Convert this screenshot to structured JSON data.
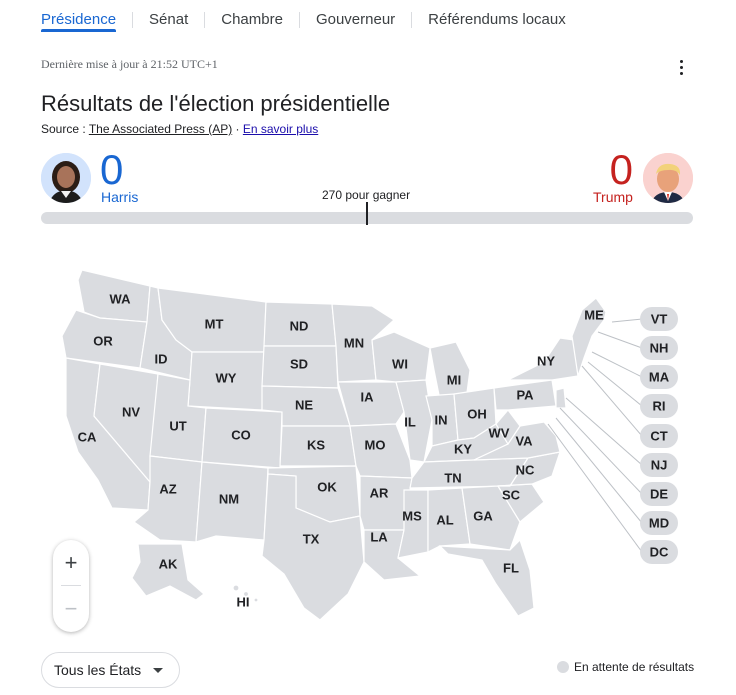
{
  "tabs": [
    {
      "label": "Présidence",
      "active": true
    },
    {
      "label": "Sénat",
      "active": false
    },
    {
      "label": "Chambre",
      "active": false
    },
    {
      "label": "Gouverneur",
      "active": false
    },
    {
      "label": "Référendums locaux",
      "active": false
    }
  ],
  "updated": "Dernière mise à jour à 21:52 UTC+1",
  "title": "Résultats de l'élection présidentielle",
  "source": {
    "prefix": "Source : ",
    "link": "The Associated Press (AP)",
    "separator": " · ",
    "more": "En savoir plus"
  },
  "candidates": {
    "left": {
      "name": "Harris",
      "votes": "0",
      "color": "#1967d2"
    },
    "right": {
      "name": "Trump",
      "votes": "0",
      "color": "#c5221f"
    }
  },
  "to_win": "270 pour gagner",
  "map": {
    "fill": "#dadce0",
    "states": [
      "WA",
      "OR",
      "CA",
      "NV",
      "ID",
      "MT",
      "WY",
      "UT",
      "AZ",
      "NM",
      "CO",
      "ND",
      "SD",
      "NE",
      "KS",
      "OK",
      "TX",
      "MN",
      "IA",
      "MO",
      "AR",
      "LA",
      "WI",
      "IL",
      "MI",
      "IN",
      "OH",
      "KY",
      "TN",
      "MS",
      "AL",
      "GA",
      "FL",
      "SC",
      "NC",
      "VA",
      "WV",
      "PA",
      "NY",
      "ME",
      "AK",
      "HI"
    ],
    "callouts": [
      "VT",
      "NH",
      "MA",
      "RI",
      "CT",
      "NJ",
      "DE",
      "MD",
      "DC"
    ]
  },
  "zoom": {
    "in": "+",
    "out": "−"
  },
  "filter": {
    "selected": "Tous les États"
  },
  "legend": {
    "pending": "En attente de résultats",
    "color": "#dadce0"
  }
}
